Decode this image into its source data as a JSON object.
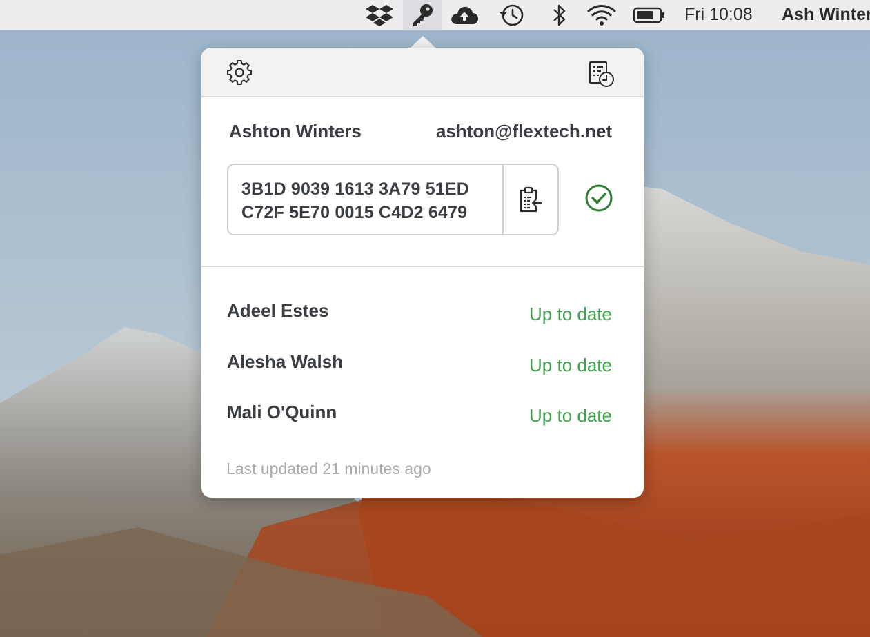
{
  "menubar": {
    "icons": [
      "dropbox-icon",
      "key-icon",
      "cloud-upload-icon",
      "time-machine-icon",
      "bluetooth-icon",
      "wifi-icon",
      "battery-icon"
    ],
    "clock": "Fri 10:08",
    "user": "Ash Winters"
  },
  "popover": {
    "header": {
      "settings_icon": "gear-icon",
      "history_icon": "history-log-icon"
    },
    "me": {
      "name": "Ashton Winters",
      "email": "ashton@flextech.net"
    },
    "fingerprint": {
      "line1": "3B1D 9039 1613 3A79 51ED",
      "line2": "C72F 5E70 0015 C4D2 6479",
      "copy_icon": "clipboard-copy-icon",
      "verified_icon": "check-circle-icon"
    },
    "contacts": [
      {
        "name": "Adeel Estes",
        "status": "Up to date"
      },
      {
        "name": "Alesha Walsh",
        "status": "Up to date"
      },
      {
        "name": "Mali O'Quinn",
        "status": "Up to date"
      }
    ],
    "footer": "Last updated 21 minutes ago"
  },
  "colors": {
    "status_green": "#3fa34d",
    "verified_green": "#2e7d32",
    "text_dark": "#3a3d42",
    "muted": "#a7a9ac"
  }
}
